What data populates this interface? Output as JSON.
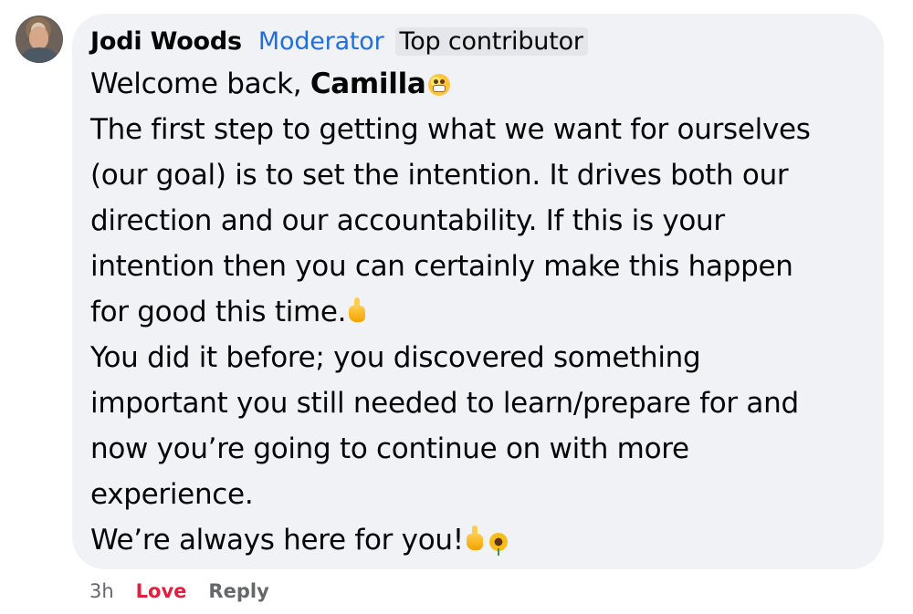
{
  "comment": {
    "author": "Jodi Woods",
    "role_label": "Moderator",
    "badge_label": "Top contributor",
    "greeting_prefix": "Welcome back, ",
    "greeting_name": "Camilla",
    "paragraph_1_lines": [
      "The first step to getting what we want for ourselves",
      "(our goal) is to set the intention. It drives both our",
      "direction and our accountability. If this is your",
      "intention then you can certainly make this happen",
      "for good this time."
    ],
    "paragraph_2_lines": [
      "You did it before; you discovered something",
      "important you still needed to learn/prepare for and",
      "now you’re going to continue on with more",
      "experience."
    ],
    "closing": "We’re always here for you!",
    "emoji": {
      "greeting": "grinning-face-with-sweat",
      "thumbs_up": "thumbs-up",
      "sunflower": "sunflower"
    }
  },
  "actions": {
    "time": "3h",
    "reaction": "Love",
    "reply": "Reply"
  },
  "colors": {
    "bubble_background": "#f0f2f5",
    "link_blue": "#216fdb",
    "love_red": "#e41e3f",
    "meta_gray": "#65676b"
  }
}
